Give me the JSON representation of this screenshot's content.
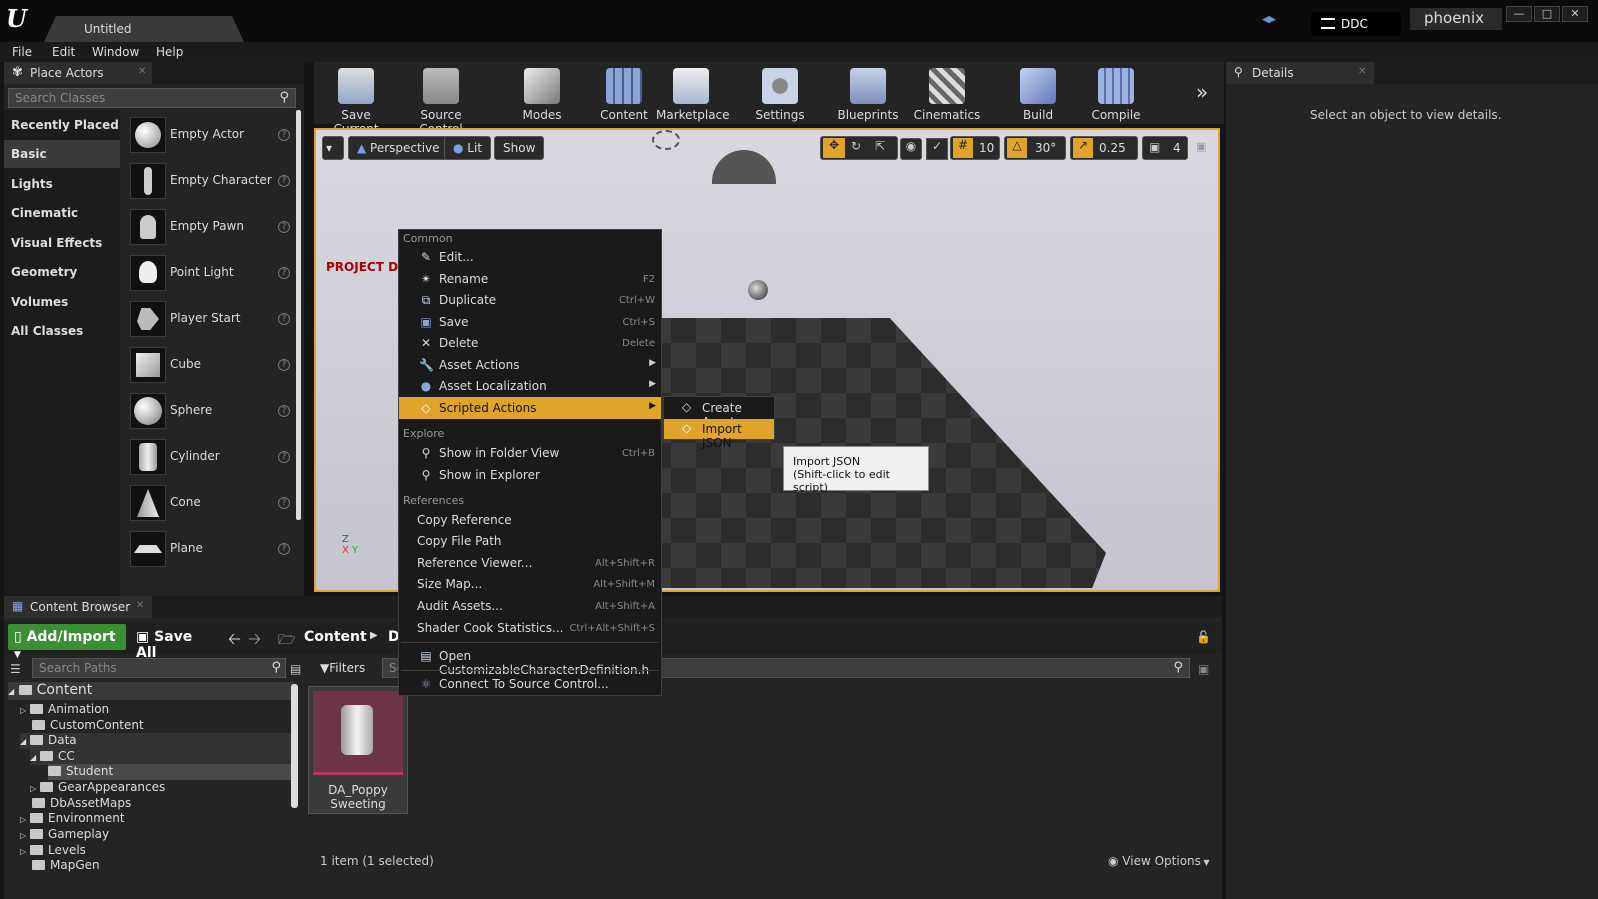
{
  "window": {
    "doc_tab": "Untitled",
    "ddc": "DDC",
    "user": "phoenix"
  },
  "menubar": {
    "items": [
      "File",
      "Edit",
      "Window",
      "Help"
    ]
  },
  "place_actors": {
    "tab": "Place Actors",
    "search_placeholder": "Search Classes",
    "categories": [
      "Recently Placed",
      "Basic",
      "Lights",
      "Cinematic",
      "Visual Effects",
      "Geometry",
      "Volumes",
      "All Classes"
    ],
    "items": [
      "Empty Actor",
      "Empty Character",
      "Empty Pawn",
      "Point Light",
      "Player Start",
      "Cube",
      "Sphere",
      "Cylinder",
      "Cone",
      "Plane"
    ]
  },
  "toolbar": {
    "buttons": [
      "Save Current",
      "Source Control",
      "Modes",
      "Content",
      "Marketplace",
      "Settings",
      "Blueprints",
      "Cinematics",
      "Build",
      "Compile"
    ]
  },
  "viewport": {
    "perspective": "Perspective",
    "lit": "Lit",
    "show": "Show",
    "grid": "10",
    "rot": "30°",
    "scale": "0.25",
    "cam": "4",
    "overlay_text": "PROJECT DC"
  },
  "details": {
    "tab": "Details",
    "message": "Select an object to view details."
  },
  "content_browser": {
    "tab": "Content Browser",
    "add_import": "Add/Import",
    "save_all": "Save All",
    "path": [
      "Content",
      "D"
    ],
    "search_paths_placeholder": "Search Paths",
    "filters": "Filters",
    "search_assets_placeholder": "Se",
    "tree": [
      {
        "label": "Content",
        "depth": 0
      },
      {
        "label": "Animation",
        "depth": 1
      },
      {
        "label": "CustomContent",
        "depth": 1
      },
      {
        "label": "Data",
        "depth": 1
      },
      {
        "label": "CC",
        "depth": 2
      },
      {
        "label": "Student",
        "depth": 3
      },
      {
        "label": "GearAppearances",
        "depth": 2
      },
      {
        "label": "DbAssetMaps",
        "depth": 1
      },
      {
        "label": "Environment",
        "depth": 1
      },
      {
        "label": "Gameplay",
        "depth": 1
      },
      {
        "label": "Levels",
        "depth": 1
      },
      {
        "label": "MapGen",
        "depth": 1
      }
    ],
    "asset_name": "DA_Poppy Sweeting",
    "status": "1 item (1 selected)",
    "view_options": "View Options"
  },
  "context_menu": {
    "sections": {
      "common": "Common",
      "explore": "Explore",
      "references": "References"
    },
    "common": [
      {
        "label": "Edit...",
        "shortcut": ""
      },
      {
        "label": "Rename",
        "shortcut": "F2"
      },
      {
        "label": "Duplicate",
        "shortcut": "Ctrl+W"
      },
      {
        "label": "Save",
        "shortcut": "Ctrl+S"
      },
      {
        "label": "Delete",
        "shortcut": "Delete"
      },
      {
        "label": "Asset Actions",
        "shortcut": ""
      },
      {
        "label": "Asset Localization",
        "shortcut": ""
      },
      {
        "label": "Scripted Actions",
        "shortcut": ""
      }
    ],
    "explore": [
      {
        "label": "Show in Folder View",
        "shortcut": "Ctrl+B"
      },
      {
        "label": "Show in Explorer",
        "shortcut": ""
      }
    ],
    "references": [
      {
        "label": "Copy Reference",
        "shortcut": ""
      },
      {
        "label": "Copy File Path",
        "shortcut": ""
      },
      {
        "label": "Reference Viewer...",
        "shortcut": "Alt+Shift+R"
      },
      {
        "label": "Size Map...",
        "shortcut": "Alt+Shift+M"
      },
      {
        "label": "Audit Assets...",
        "shortcut": "Alt+Shift+A"
      },
      {
        "label": "Shader Cook Statistics...",
        "shortcut": "Ctrl+Alt+Shift+S"
      }
    ],
    "open_header": "Open CustomizableCharacterDefinition.h",
    "connect_sc": "Connect To Source Control..."
  },
  "submenu": {
    "items": [
      "Create Asset",
      "Import JSON"
    ]
  },
  "tooltip": {
    "line1": "Import JSON",
    "line2": "(Shift-click to edit script)"
  },
  "colors": {
    "accent": "#e0a42a",
    "add_import": "#3a8f35"
  }
}
